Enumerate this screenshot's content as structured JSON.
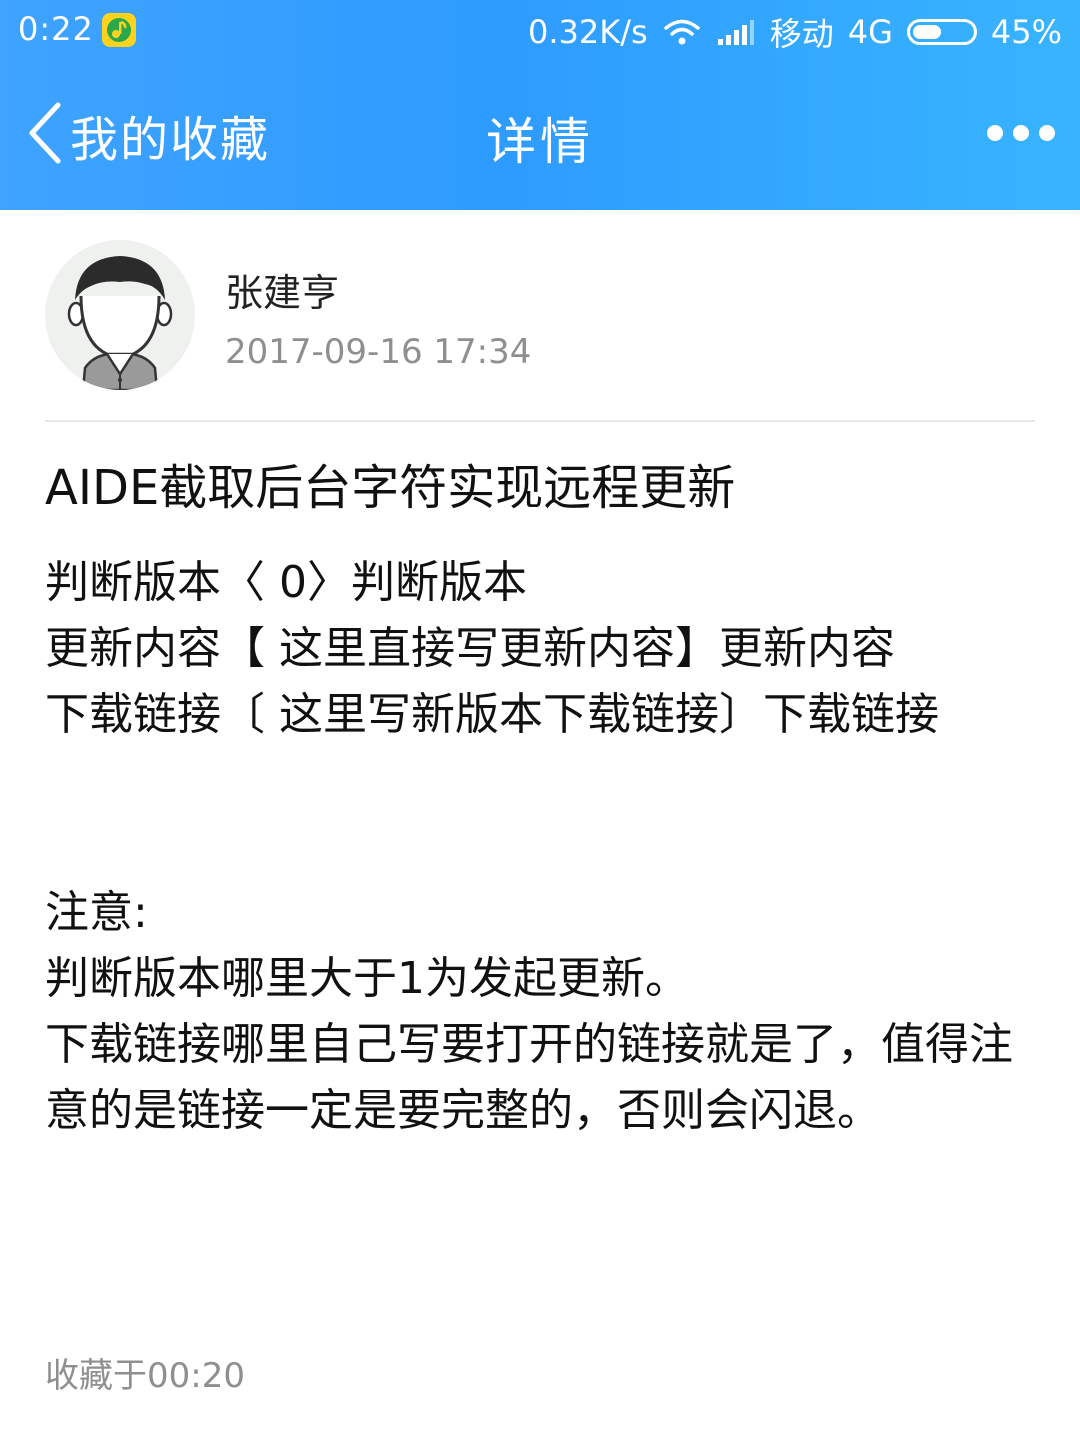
{
  "status_bar": {
    "time": "0:22",
    "network_speed": "0.32K/s",
    "carrier": "移动",
    "network_type": "4G",
    "battery": "45%",
    "battery_level": 0.45,
    "icons": [
      "qq-music-icon",
      "wifi-icon",
      "signal-icon",
      "battery-icon"
    ]
  },
  "nav": {
    "back_label": "我的收藏",
    "title": "详情",
    "more_icon": "more-dots-icon"
  },
  "author": {
    "name": "张建亨",
    "time": "2017-09-16 17:34"
  },
  "post": {
    "title": "AIDE截取后台字符实现远程更新",
    "lines": [
      "判断版本〈 0〉判断版本",
      "更新内容【 这里直接写更新内容】更新内容",
      "下载链接〔 这里写新版本下载链接〕下载链接"
    ],
    "notes": [
      "注意:",
      "判断版本哪里大于1为发起更新。",
      "下载链接哪里自己写要打开的链接就是了，值得注意的是链接一定是要完整的，否则会闪退。"
    ]
  },
  "footer": {
    "favorited_at": "收藏于00:20"
  },
  "colors": {
    "header_bg": "#2e9bff",
    "text_primary": "#111111",
    "text_secondary": "#8f8f8f"
  }
}
